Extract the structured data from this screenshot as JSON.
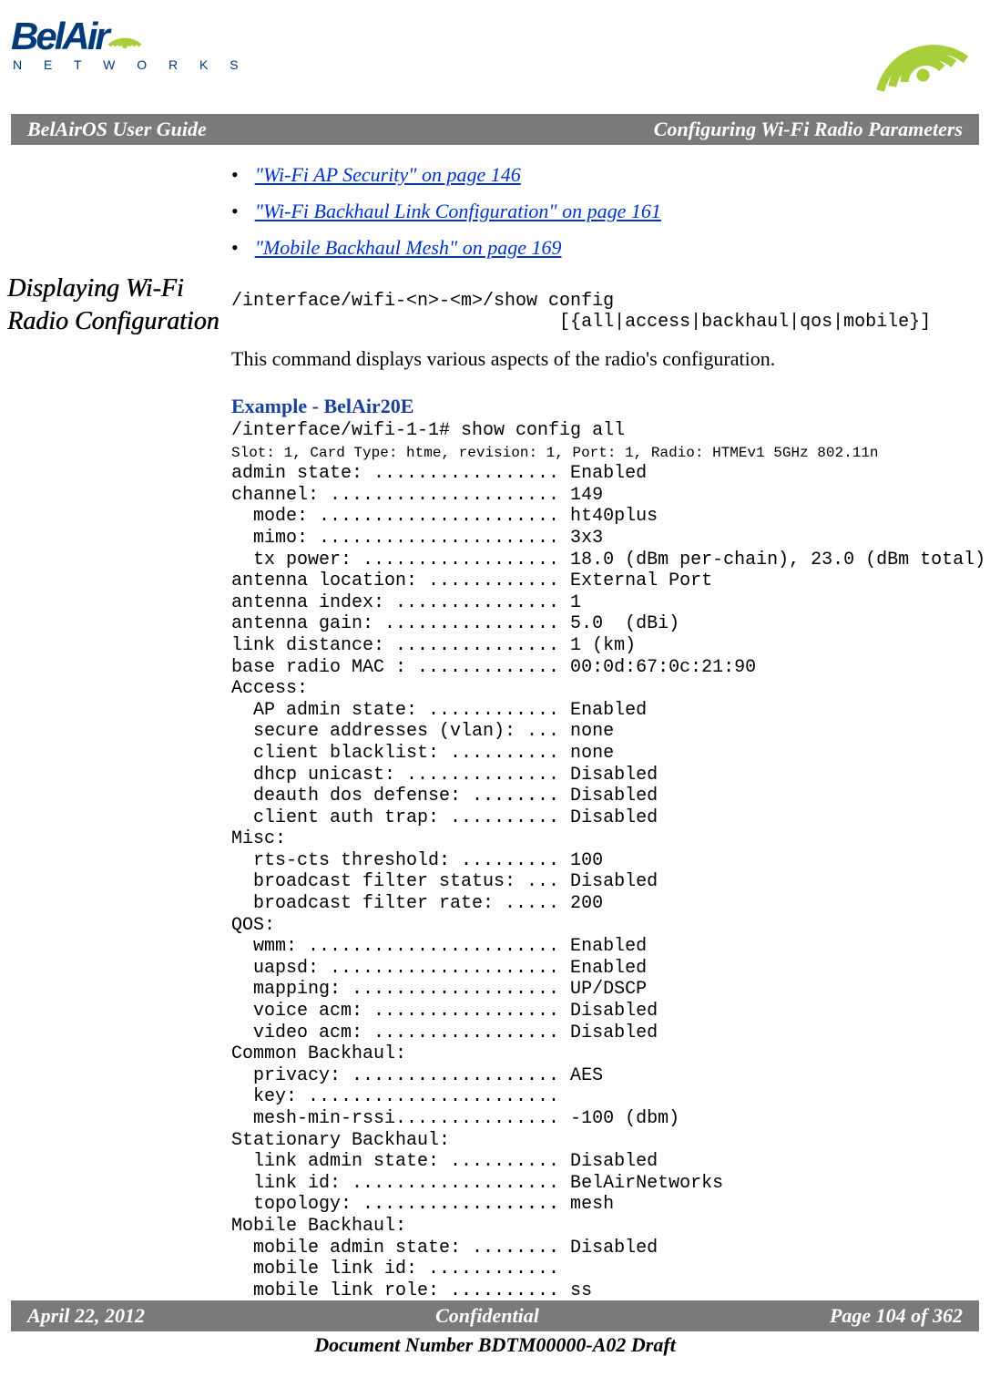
{
  "logo": {
    "brand": "BelAir",
    "sub": "N  E  T  W  O  R  K  S"
  },
  "header_bar": {
    "left": "BelAirOS User Guide",
    "right": "Configuring Wi-Fi Radio Parameters"
  },
  "bullets": [
    {
      "label": "\"Wi-Fi AP Security\" on page 146"
    },
    {
      "label": "\"Wi-Fi Backhaul Link Configuration\" on page 161"
    },
    {
      "label": "\"Mobile Backhaul Mesh\" on page 169"
    }
  ],
  "section": {
    "title": "Displaying Wi-Fi Radio Configuration",
    "command": "/interface/wifi-<n>-<m>/show config\n                              [{all|access|backhaul|qos|mobile}]",
    "description": "This command displays various aspects of the radio's configuration.",
    "example_heading": "Example - BelAir20E",
    "console_line1": "/interface/wifi-1-1# show config all",
    "console_small": "Slot: 1, Card Type: htme, revision: 1, Port: 1, Radio: HTMEv1 5GHz 802.11n",
    "console_rest": "admin state: ................. Enabled\nchannel: ..................... 149\n  mode: ...................... ht40plus\n  mimo: ...................... 3x3\n  tx power: .................. 18.0 (dBm per-chain), 23.0 (dBm total)\nantenna location: ............ External Port\nantenna index: ............... 1\nantenna gain: ................ 5.0  (dBi)\nlink distance: ............... 1 (km)\nbase radio MAC : ............. 00:0d:67:0c:21:90\nAccess:\n  AP admin state: ............ Enabled\n  secure addresses (vlan): ... none\n  client blacklist: .......... none\n  dhcp unicast: .............. Disabled\n  deauth dos defense: ........ Disabled\n  client auth trap: .......... Disabled\nMisc:\n  rts-cts threshold: ......... 100\n  broadcast filter status: ... Disabled\n  broadcast filter rate: ..... 200\nQOS:\n  wmm: ....................... Enabled\n  uapsd: ..................... Enabled\n  mapping: ................... UP/DSCP\n  voice acm: ................. Disabled\n  video acm: ................. Disabled\nCommon Backhaul:\n  privacy: ................... AES\n  key: .......................\n  mesh-min-rssi............... -100 (dbm)\nStationary Backhaul:\n  link admin state: .......... Disabled\n  link id: ................... BelAirNetworks\n  topology: .................. mesh\nMobile Backhaul:\n  mobile admin state: ........ Disabled\n  mobile link id: ............\n  mobile link role: .......... ss"
  },
  "footer": {
    "date": "April 22, 2012",
    "confidential": "Confidential",
    "page": "Page 104 of 362",
    "docnum": "Document Number BDTM00000-A02 Draft"
  }
}
